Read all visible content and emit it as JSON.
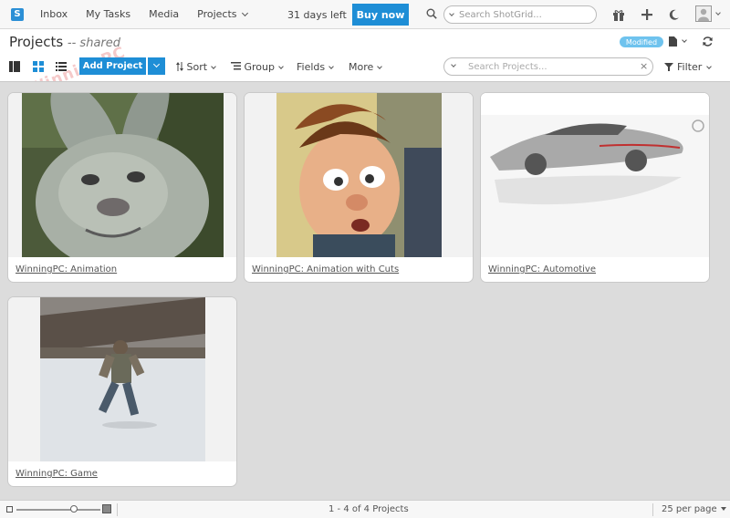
{
  "nav": {
    "logo": "S",
    "links": [
      "Inbox",
      "My Tasks",
      "Media",
      "Projects"
    ],
    "trial": "31 days left",
    "buy": "Buy now",
    "search_placeholder": "Search ShotGrid..."
  },
  "page": {
    "title": "Projects",
    "subtitle": "-- shared",
    "badge": "Modified",
    "watermark": "WinningPC"
  },
  "toolbar": {
    "add_label": "Add Project",
    "sort": "Sort",
    "group": "Group",
    "fields": "Fields",
    "more": "More",
    "search_placeholder": "Search Projects...",
    "filter": "Filter"
  },
  "projects": [
    {
      "label": "WinningPC: Animation",
      "thumb": "rabbit"
    },
    {
      "label": "WinningPC: Animation with Cuts",
      "thumb": "cartoon-face"
    },
    {
      "label": "WinningPC: Automotive",
      "thumb": "car-sketch"
    },
    {
      "label": "WinningPC: Game",
      "thumb": "soldier-running"
    }
  ],
  "footer": {
    "count": "1 - 4 of 4 Projects",
    "per_page": "25 per page"
  },
  "colors": {
    "accent": "#1e8ed6",
    "badge": "#6fc3ee",
    "grid_bg": "#dcdcdc"
  }
}
